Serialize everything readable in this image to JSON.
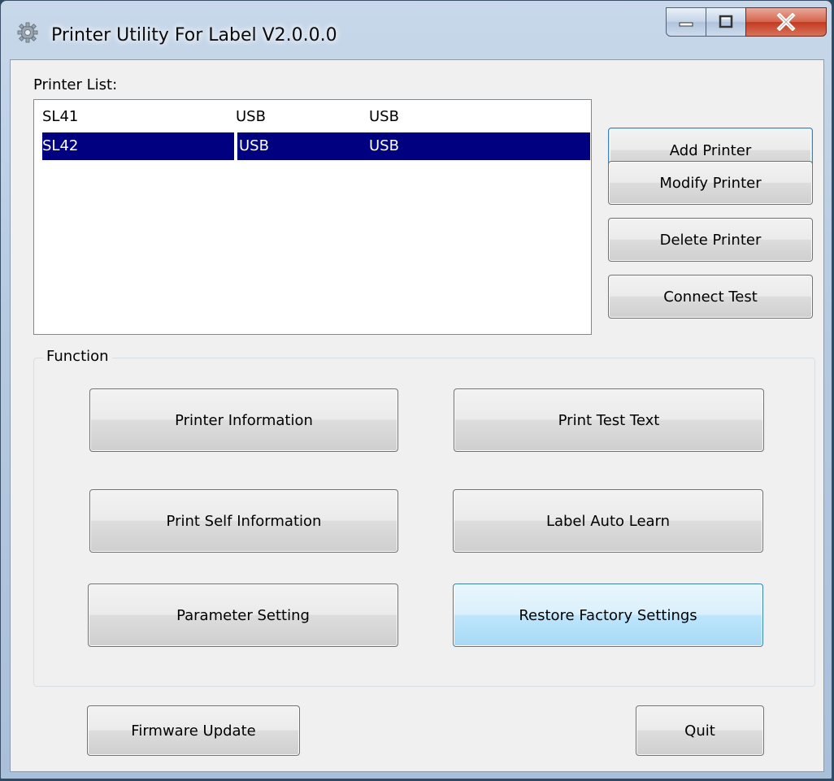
{
  "window": {
    "title": "Printer Utility For Label  V2.0.0.0",
    "controls": {
      "minimize": "minimize",
      "maximize": "maximize",
      "close": "close"
    }
  },
  "printer_list": {
    "label": "Printer List:",
    "rows": [
      {
        "name": "SL41",
        "port": "USB",
        "type": "USB",
        "selected": false
      },
      {
        "name": "SL42",
        "port": "USB",
        "type": "USB",
        "selected": true
      }
    ]
  },
  "side_buttons": {
    "add": "Add Printer",
    "modify": "Modify Printer",
    "delete": "Delete Printer",
    "connect_test": "Connect Test"
  },
  "function_group": {
    "title": "Function",
    "buttons": {
      "printer_information": "Printer Information",
      "print_test_text": "Print Test Text",
      "print_self_information": "Print Self Information",
      "label_auto_learn": "Label Auto Learn",
      "parameter_setting": "Parameter Setting",
      "restore_factory_settings": "Restore Factory Settings"
    }
  },
  "bottom_buttons": {
    "firmware_update": "Firmware Update",
    "quit": "Quit"
  },
  "colors": {
    "selection": "#000080",
    "default_button_border": "#3c7fb1",
    "close_button": "#c43a20"
  }
}
